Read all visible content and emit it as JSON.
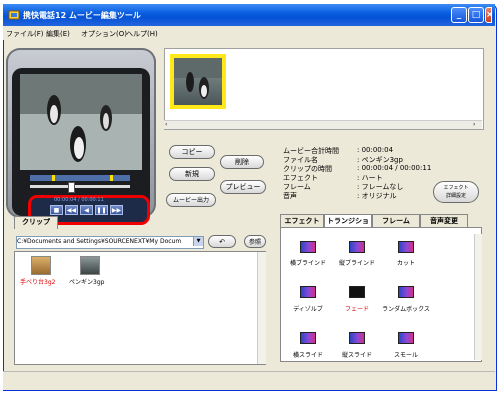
{
  "window": {
    "title": "携快電話12 ムービー編集ツール"
  },
  "menu": [
    {
      "label": "ファイル(F)"
    },
    {
      "label": "編集(E)"
    },
    {
      "label": "オプション(O)"
    },
    {
      "label": "ヘルプ(H)"
    }
  ],
  "player": {
    "time": "00:00:04 / 00:00:11"
  },
  "actions": {
    "copy": "コピー",
    "delete": "削除",
    "new": "新規",
    "preview": "プレビュー",
    "movie_out": "ムービー出力",
    "detail": "エフェクト\n詳細設定"
  },
  "info": {
    "rows": [
      {
        "label": "ムービー合計時間",
        "value": ": 00:00:04"
      },
      {
        "label": "ファイル名",
        "value": ": ペンギン3gp"
      },
      {
        "label": "クリップの時間",
        "value": ": 00:00:04 / 00:00:11"
      },
      {
        "label": "エフェクト",
        "value": ": ハート"
      },
      {
        "label": "フレーム",
        "value": ": フレームなし"
      },
      {
        "label": "音声",
        "value": ": オリジナル"
      }
    ]
  },
  "tabs": [
    {
      "label": "エフェクト"
    },
    {
      "label": "トランジション"
    },
    {
      "label": "フレーム"
    },
    {
      "label": "音声変更"
    }
  ],
  "effects": [
    {
      "label": "横ブラインド"
    },
    {
      "label": "縦ブラインド"
    },
    {
      "label": "カット"
    },
    {
      "label": "ディゾルブ"
    },
    {
      "label": "フェード"
    },
    {
      "label": "ランダムボックス"
    },
    {
      "label": "横スライド"
    },
    {
      "label": "縦スライド"
    },
    {
      "label": "スモール"
    }
  ],
  "clips_panel": {
    "tab": "クリップ",
    "path": "C:¥Documents and Settings¥SOURCENEXT¥My Docum",
    "browse": "参照",
    "files": [
      {
        "name": "手べり台3g2"
      },
      {
        "name": "ペンギン3gp"
      }
    ]
  },
  "colors": {
    "titlebar": "#0a5fe0",
    "highlight": "#e00000",
    "selected_label": "#e00000"
  }
}
